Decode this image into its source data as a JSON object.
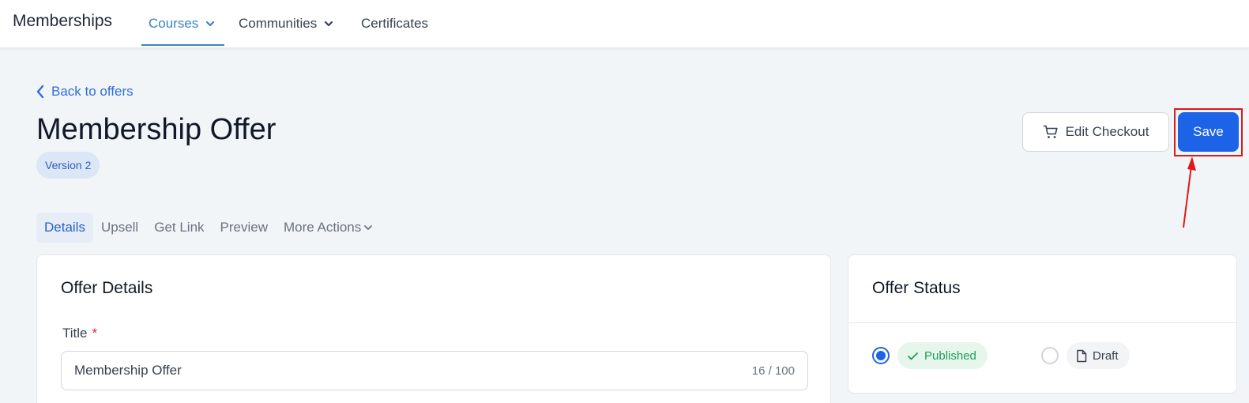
{
  "nav": {
    "brand": "Memberships",
    "items": [
      {
        "label": "Courses",
        "active": true,
        "dropdown": true
      },
      {
        "label": "Communities",
        "active": false,
        "dropdown": true
      },
      {
        "label": "Certificates",
        "active": false,
        "dropdown": false
      }
    ]
  },
  "header": {
    "back_label": "Back to offers",
    "title": "Membership Offer",
    "version_badge": "Version 2",
    "edit_checkout_label": "Edit Checkout",
    "save_label": "Save"
  },
  "tabs": [
    {
      "label": "Details",
      "active": true
    },
    {
      "label": "Upsell",
      "active": false
    },
    {
      "label": "Get Link",
      "active": false
    },
    {
      "label": "Preview",
      "active": false
    },
    {
      "label": "More Actions",
      "active": false,
      "dropdown": true
    }
  ],
  "offer_details": {
    "heading": "Offer Details",
    "title_label": "Title",
    "required_mark": "*",
    "title_value": "Membership Offer",
    "char_count": "16 / 100"
  },
  "offer_status": {
    "heading": "Offer Status",
    "options": [
      {
        "label": "Published",
        "selected": true
      },
      {
        "label": "Draft",
        "selected": false
      }
    ]
  },
  "colors": {
    "accent": "#1d63e8",
    "nav_active": "#3b82c4",
    "highlight": "#e01818",
    "published": "#1f9d55"
  }
}
